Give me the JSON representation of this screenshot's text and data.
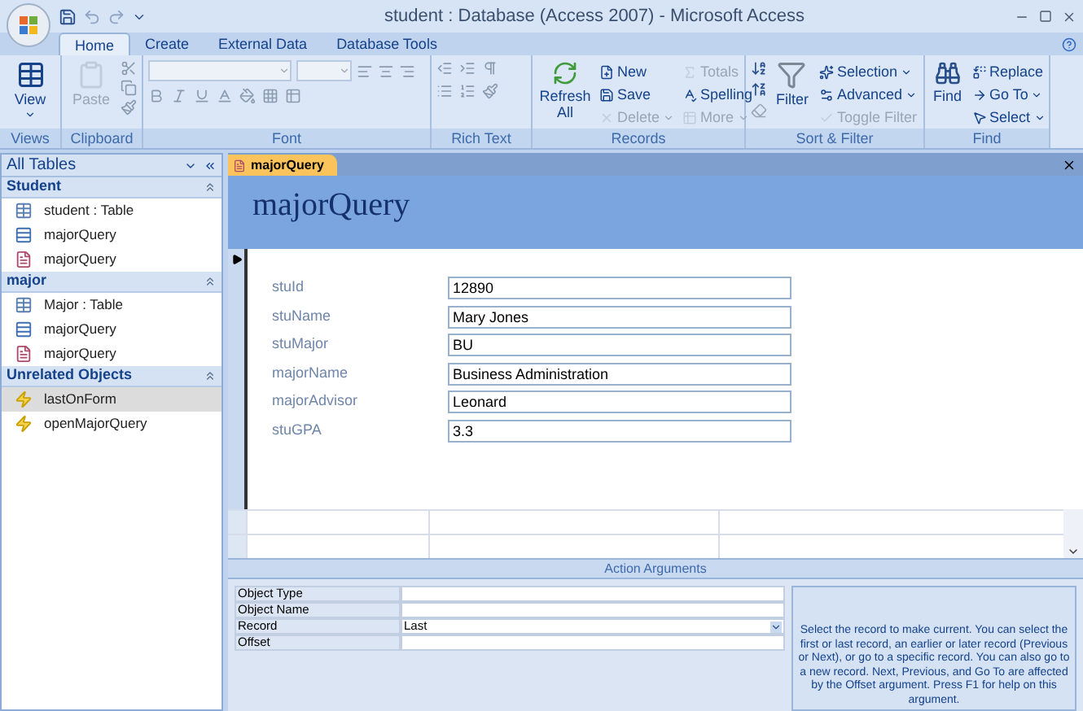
{
  "window": {
    "title": "student : Database (Access 2007) - Microsoft Access"
  },
  "ribbon_tabs": [
    {
      "label": "Home",
      "selected": true
    },
    {
      "label": "Create",
      "selected": false
    },
    {
      "label": "External Data",
      "selected": false
    },
    {
      "label": "Database Tools",
      "selected": false
    }
  ],
  "ribbon": {
    "groups": [
      {
        "label": "Views",
        "buttons": [
          {
            "label": "View",
            "disabled": false
          }
        ]
      },
      {
        "label": "Clipboard",
        "buttons": [
          {
            "label": "Paste",
            "disabled": true
          }
        ]
      },
      {
        "label": "Font"
      },
      {
        "label": "Rich Text"
      },
      {
        "label": "Records",
        "buttons": [
          {
            "label": "Refresh All",
            "disabled": false
          },
          {
            "label": "New",
            "disabled": false
          },
          {
            "label": "Save",
            "disabled": false
          },
          {
            "label": "Delete",
            "disabled": true
          },
          {
            "label": "Totals",
            "disabled": true
          },
          {
            "label": "Spelling",
            "disabled": false
          },
          {
            "label": "More",
            "disabled": true
          }
        ]
      },
      {
        "label": "Sort & Filter",
        "buttons": [
          {
            "label": "Filter",
            "disabled": false
          },
          {
            "label": "Selection",
            "disabled": false
          },
          {
            "label": "Advanced",
            "disabled": false
          },
          {
            "label": "Toggle Filter",
            "disabled": true
          }
        ]
      },
      {
        "label": "Find",
        "buttons": [
          {
            "label": "Find",
            "disabled": false
          },
          {
            "label": "Replace",
            "disabled": false
          },
          {
            "label": "Go To",
            "disabled": false
          },
          {
            "label": "Select",
            "disabled": false
          }
        ]
      }
    ]
  },
  "navigation": {
    "title": "All Tables",
    "groups": [
      {
        "label": "Student",
        "items": [
          {
            "label": "student : Table",
            "kind": "table",
            "selected": false
          },
          {
            "label": "majorQuery",
            "kind": "query",
            "selected": false
          },
          {
            "label": "majorQuery",
            "kind": "form",
            "selected": false
          }
        ]
      },
      {
        "label": "major",
        "items": [
          {
            "label": "Major : Table",
            "kind": "table",
            "selected": false
          },
          {
            "label": "majorQuery",
            "kind": "query",
            "selected": false
          },
          {
            "label": "majorQuery",
            "kind": "form",
            "selected": false
          }
        ]
      },
      {
        "label": "Unrelated Objects",
        "items": [
          {
            "label": "lastOnForm",
            "kind": "macro",
            "selected": true
          },
          {
            "label": "openMajorQuery",
            "kind": "macro",
            "selected": false
          }
        ]
      }
    ]
  },
  "document_tabs": [
    {
      "label": "majorQuery",
      "selected": true
    }
  ],
  "form": {
    "title": "majorQuery",
    "fields": [
      {
        "label": "stuId",
        "value": "12890"
      },
      {
        "label": "stuName",
        "value": "Mary Jones"
      },
      {
        "label": "stuMajor",
        "value": "BU"
      },
      {
        "label": "majorName",
        "value": "Business Administration"
      },
      {
        "label": "majorAdvisor",
        "value": "Leonard"
      },
      {
        "label": "stuGPA",
        "value": "3.3"
      }
    ]
  },
  "action_arguments": {
    "title": "Action Arguments",
    "rows": [
      {
        "label": "Object Type"
      },
      {
        "label": "Object Name"
      },
      {
        "label": "Record",
        "value": "Last",
        "kind": "dropdown"
      },
      {
        "label": "Offset"
      }
    ],
    "help": "Select the record to make current. You can select the first or last record, an earlier or later record (Previous or Next), or go to a specific record. You can also go to a new record. Next, Previous, and Go To are affected by the Offset argument. Press F1 for help on this argument."
  }
}
